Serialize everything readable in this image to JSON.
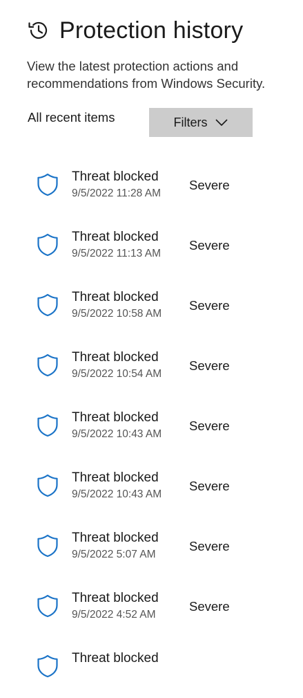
{
  "header": {
    "title": "Protection history",
    "icon": "history-icon"
  },
  "description": "View the latest protection actions and recommendations from Windows Security.",
  "toolbar": {
    "recent_label": "All recent items",
    "filters_label": "Filters",
    "filters_icon": "chevron-down-icon"
  },
  "colors": {
    "accent": "#1a73c7",
    "filter_button_bg": "#cccccc"
  },
  "items": [
    {
      "title": "Threat blocked",
      "time": "9/5/2022 11:28 AM",
      "severity": "Severe",
      "icon": "shield-icon"
    },
    {
      "title": "Threat blocked",
      "time": "9/5/2022 11:13 AM",
      "severity": "Severe",
      "icon": "shield-icon"
    },
    {
      "title": "Threat blocked",
      "time": "9/5/2022 10:58 AM",
      "severity": "Severe",
      "icon": "shield-icon"
    },
    {
      "title": "Threat blocked",
      "time": "9/5/2022 10:54 AM",
      "severity": "Severe",
      "icon": "shield-icon"
    },
    {
      "title": "Threat blocked",
      "time": "9/5/2022 10:43 AM",
      "severity": "Severe",
      "icon": "shield-icon"
    },
    {
      "title": "Threat blocked",
      "time": "9/5/2022 10:43 AM",
      "severity": "Severe",
      "icon": "shield-icon"
    },
    {
      "title": "Threat blocked",
      "time": "9/5/2022 5:07 AM",
      "severity": "Severe",
      "icon": "shield-icon"
    },
    {
      "title": "Threat blocked",
      "time": "9/5/2022 4:52 AM",
      "severity": "Severe",
      "icon": "shield-icon"
    },
    {
      "title": "Threat blocked",
      "time": "",
      "severity": "",
      "icon": "shield-icon"
    }
  ]
}
